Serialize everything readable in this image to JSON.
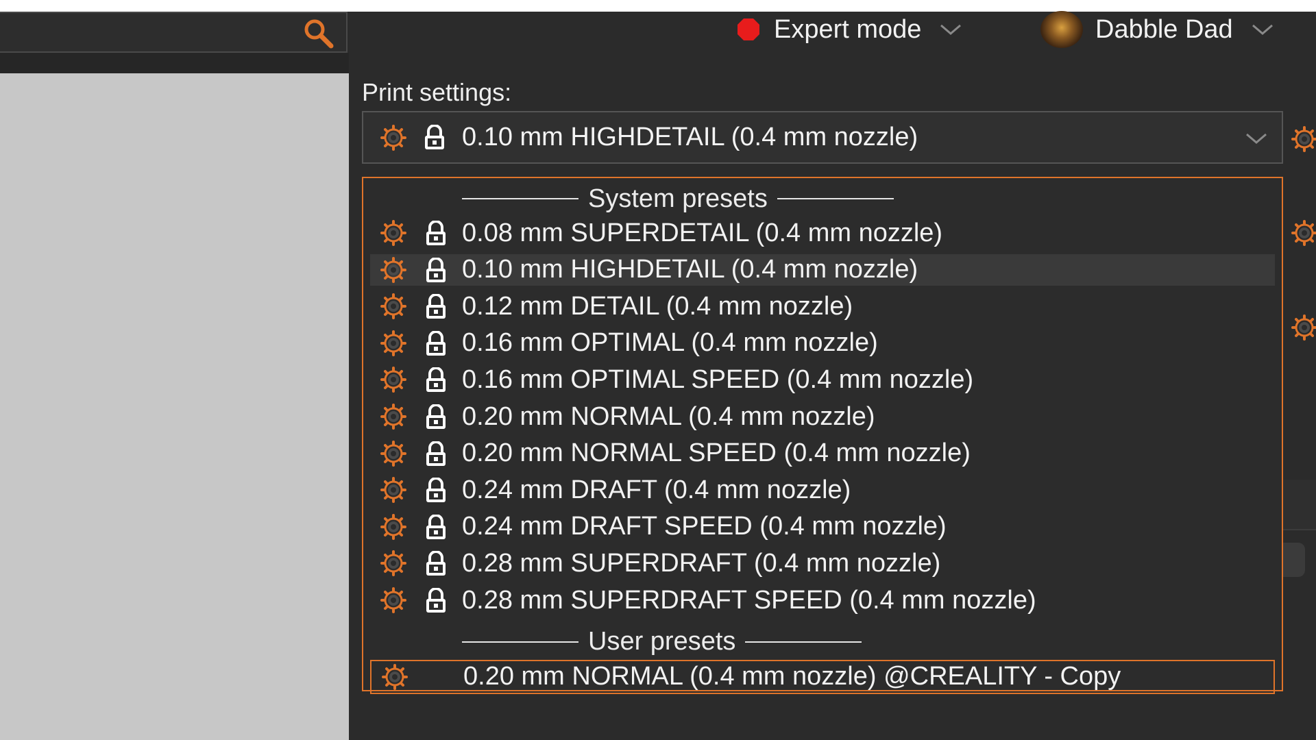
{
  "header": {
    "mode_label": "Expert mode",
    "user_name": "Dabble Dad",
    "colors": {
      "mode_dot": "#e81c1c",
      "accent": "#e0742a"
    }
  },
  "print_settings": {
    "label": "Print settings:",
    "selected": "0.10 mm HIGHDETAIL (0.4 mm nozzle)"
  },
  "dropdown": {
    "system_header": "System presets",
    "system_presets": [
      "0.08 mm SUPERDETAIL (0.4 mm nozzle)",
      "0.10 mm HIGHDETAIL (0.4 mm nozzle)",
      "0.12 mm DETAIL (0.4 mm nozzle)",
      "0.16 mm OPTIMAL (0.4 mm nozzle)",
      "0.16 mm OPTIMAL SPEED (0.4 mm nozzle)",
      "0.20 mm NORMAL (0.4 mm nozzle)",
      "0.20 mm NORMAL SPEED (0.4 mm nozzle)",
      "0.24 mm DRAFT (0.4 mm nozzle)",
      "0.24 mm DRAFT SPEED (0.4 mm nozzle)",
      "0.28 mm SUPERDRAFT (0.4 mm nozzle)",
      "0.28 mm SUPERDRAFT SPEED (0.4 mm nozzle)"
    ],
    "user_header": "User presets",
    "user_presets": [
      "0.20 mm NORMAL (0.4 mm nozzle) @CREALITY - Copy"
    ],
    "highlighted": "0.10 mm HIGHDETAIL (0.4 mm nozzle)",
    "selected": "0.20 mm NORMAL (0.4 mm nozzle) @CREALITY - Copy"
  }
}
